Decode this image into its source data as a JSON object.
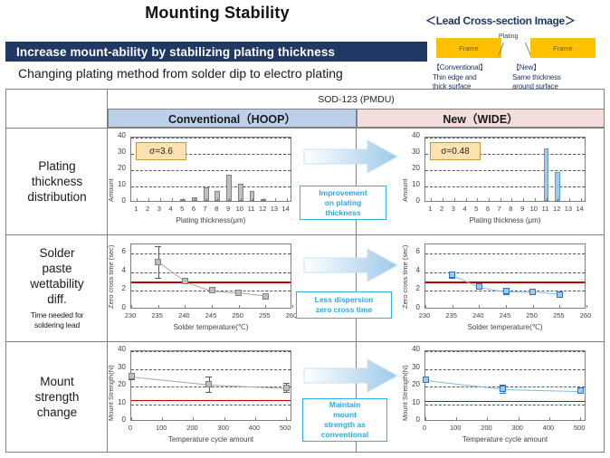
{
  "header": {
    "main_title": "Mounting Stability",
    "cross_section_title": "＜Lead Cross-section Image＞",
    "banner": "Increase mount-ability by stabilizing  plating thickness",
    "subbanner": "Changing plating method from solder dip to electro plating"
  },
  "cross_section": {
    "frame_left_label": "Frame",
    "frame_right_label": "Frame",
    "plating_label": "Plating",
    "caption_left": "【Conventional】\nThin edge and\nthick surface",
    "caption_left_l1": "【Conventional】",
    "caption_left_l2": "Thin edge and",
    "caption_left_l3": "thick surface",
    "caption_right_l1": "【New】",
    "caption_right_l2": "Same thickness",
    "caption_right_l3": "around surface",
    "frame_color": "#FFC000"
  },
  "table": {
    "part_number": "SOD-123 (PMDU)",
    "col_conventional": "Conventional（HOOP）",
    "col_new": "New（WIDE）",
    "col_conventional_bg": "#BDD0E9",
    "col_new_bg": "#F3DDDC",
    "rows": [
      {
        "label_l1": "Plating",
        "label_l2": "thickness",
        "label_l3": "distribution",
        "sub": ""
      },
      {
        "label_l1": "Solder",
        "label_l2": "paste",
        "label_l3": "wettability",
        "label_l4": "diff.",
        "sub_l1": "Time needed for",
        "sub_l2": "soldering  lead"
      },
      {
        "label_l1": "Mount",
        "label_l2": "strength",
        "label_l3": "change",
        "sub": ""
      }
    ]
  },
  "callouts": [
    {
      "l1": "Improvement",
      "l2": "on plating",
      "l3": "thickness"
    },
    {
      "l1": "Less dispersion",
      "l2": "zero cross time"
    },
    {
      "l1": "Maintain",
      "l2": "mount",
      "l3": "strength as",
      "l4": "conventional"
    }
  ],
  "chart_data": [
    {
      "id": "plating-conventional",
      "type": "bar",
      "title": "",
      "xlabel": "Plating  thickness(μm)",
      "ylabel": "Amount",
      "annotation": "σ=3.6",
      "categories": [
        "1",
        "2",
        "3",
        "4",
        "5",
        "6",
        "7",
        "8",
        "9",
        "10",
        "11",
        "12",
        "13",
        "14"
      ],
      "values": [
        0,
        0,
        0,
        0,
        0.8,
        2.2,
        8.4,
        6.2,
        16.2,
        10.4,
        6.3,
        0.8,
        0,
        0
      ],
      "ylim": [
        0,
        40
      ],
      "yticks": [
        0,
        10,
        20,
        30,
        40
      ],
      "grid": true,
      "bar_color": "#BFBFBF",
      "bar_border": "#808080"
    },
    {
      "id": "plating-new",
      "type": "bar",
      "title": "",
      "xlabel": "Plating thickness (μm)",
      "ylabel": "Amount",
      "annotation": "σ=0.48",
      "categories": [
        "1",
        "2",
        "3",
        "4",
        "5",
        "6",
        "7",
        "8",
        "9",
        "10",
        "11",
        "12",
        "13",
        "14"
      ],
      "values": [
        0,
        0,
        0,
        0,
        0,
        0,
        0,
        0,
        0,
        0,
        32.0,
        18.0,
        0,
        0
      ],
      "ylim": [
        0,
        40
      ],
      "yticks": [
        0,
        10,
        20,
        30,
        40
      ],
      "grid": true,
      "bar_color": "#9DC9EA",
      "bar_border": "#5B9BD5"
    },
    {
      "id": "wettability-conventional",
      "type": "line",
      "title": "",
      "xlabel": "Solder temperature(℃)",
      "ylabel": "Zero cross time (sec)",
      "x": [
        235,
        240,
        245,
        250,
        255
      ],
      "values": [
        5.15,
        3.05,
        2.05,
        1.8,
        1.45
      ],
      "errors": [
        1.7,
        0.25,
        0.15,
        0.12,
        0.1
      ],
      "xlim": [
        230,
        260
      ],
      "xticks": [
        230,
        235,
        240,
        245,
        250,
        255,
        260
      ],
      "ylim": [
        0,
        7
      ],
      "yticks": [
        0,
        2,
        4,
        6
      ],
      "threshold": 3.0,
      "threshold_color": "#C00000",
      "grid": true,
      "marker_color": "#BFBFBF",
      "line_color": "#A6A6A6"
    },
    {
      "id": "wettability-new",
      "type": "line",
      "title": "",
      "xlabel": "Solder temperature(℃)",
      "ylabel": "Zero cross time (sec)",
      "x": [
        235,
        240,
        245,
        250,
        255
      ],
      "values": [
        3.7,
        2.45,
        1.95,
        1.9,
        1.65
      ],
      "errors": [
        0.25,
        0.2,
        0.25,
        0.22,
        0.15
      ],
      "xlim": [
        230,
        260
      ],
      "xticks": [
        230,
        235,
        240,
        245,
        250,
        255,
        260
      ],
      "ylim": [
        0,
        7
      ],
      "yticks": [
        0,
        2,
        4,
        6
      ],
      "threshold": 3.0,
      "threshold_color": "#C00000",
      "grid": true,
      "marker_color": "#9DC9EA",
      "line_color": "#7FBCE3"
    },
    {
      "id": "strength-conventional",
      "type": "line",
      "title": "",
      "xlabel": "Temperature cycle amount",
      "ylabel": "Mount Strength(N)",
      "x": [
        0,
        250,
        500
      ],
      "values": [
        25.7,
        21.2,
        19.3
      ],
      "errors": [
        1.6,
        4.3,
        2.6
      ],
      "xlim": [
        0,
        520
      ],
      "xticks": [
        0,
        100,
        200,
        300,
        400,
        500
      ],
      "ylim": [
        0,
        40
      ],
      "yticks": [
        0,
        10,
        20,
        30,
        40
      ],
      "threshold": 12.3,
      "threshold_color": "#C00000",
      "grid": true,
      "marker_color": "#BFBFBF",
      "line_color": "#A6A6A6"
    },
    {
      "id": "strength-new",
      "type": "line",
      "title": "",
      "xlabel": "Temperature cycle amount",
      "ylabel": "Mount Strength(N)",
      "x": [
        0,
        250,
        500
      ],
      "values": [
        23.6,
        18.7,
        17.6
      ],
      "errors": [
        1.2,
        2.4,
        1.3
      ],
      "xlim": [
        0,
        520
      ],
      "xticks": [
        0,
        100,
        200,
        300,
        400,
        500
      ],
      "ylim": [
        0,
        40
      ],
      "yticks": [
        0,
        10,
        20,
        30,
        40
      ],
      "threshold": 12.0,
      "threshold_color": "#C00000",
      "grid": true,
      "marker_color": "#9DC9EA",
      "line_color": "#7FBCE3"
    }
  ]
}
